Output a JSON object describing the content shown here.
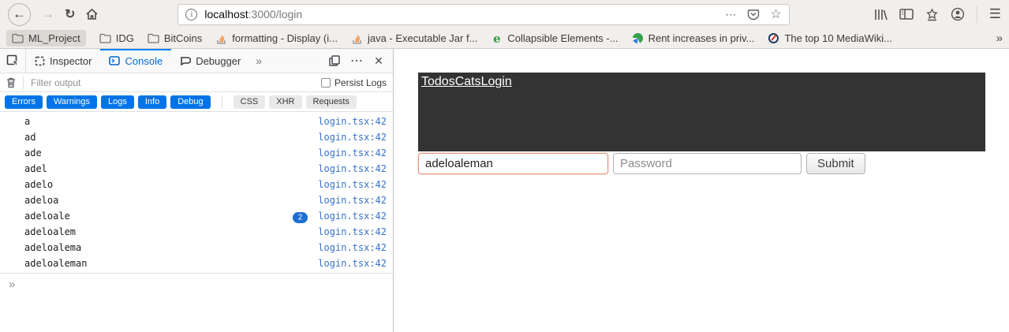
{
  "colors": {
    "accent_blue": "#0074e8",
    "active_tab_blue": "#0669cc",
    "link_blue": "#3672c8",
    "badge_blue": "#1d6fd3",
    "focus_orange": "#e8937c",
    "header_dark": "#333333",
    "chrome_grey": "#f1efed"
  },
  "glyphs": {
    "back": "←",
    "forward": "→",
    "reload": "↻",
    "info": "i",
    "page_actions": "⋯",
    "bookmark_star": "☆",
    "menu": "☰",
    "overflow": "»",
    "more_tabs": "»",
    "meatball": "⋯",
    "close": "✕",
    "prompt": "»",
    "e_favicon": "e"
  },
  "browser": {
    "url_host": "localhost",
    "url_suffix": ":3000/login"
  },
  "bookmarks": {
    "items": [
      {
        "label": "ML_Project",
        "icon": "folder"
      },
      {
        "label": "IDG",
        "icon": "folder"
      },
      {
        "label": "BitCoins",
        "icon": "folder"
      },
      {
        "label": "formatting - Display (i...",
        "icon": "stackoverflow"
      },
      {
        "label": "java - Executable Jar f...",
        "icon": "stackoverflow"
      },
      {
        "label": "Collapsible Elements -...",
        "icon": "e-green"
      },
      {
        "label": "Rent increases in priv...",
        "icon": "circle-green-blue"
      },
      {
        "label": "The top 10 MediaWiki...",
        "icon": "compass"
      }
    ]
  },
  "devtools": {
    "tabs": [
      {
        "label": "Inspector"
      },
      {
        "label": "Console"
      },
      {
        "label": "Debugger"
      }
    ],
    "filter": {
      "placeholder": "Filter output",
      "persist_label": "Persist Logs"
    },
    "level_pills": [
      {
        "label": "Errors"
      },
      {
        "label": "Warnings"
      },
      {
        "label": "Logs"
      },
      {
        "label": "Info"
      },
      {
        "label": "Debug"
      }
    ],
    "type_pills": [
      {
        "label": "CSS"
      },
      {
        "label": "XHR"
      },
      {
        "label": "Requests"
      }
    ],
    "console": {
      "rows": [
        {
          "text": "a",
          "location": "login.tsx:42"
        },
        {
          "text": "ad",
          "location": "login.tsx:42"
        },
        {
          "text": "ade",
          "location": "login.tsx:42"
        },
        {
          "text": "adel",
          "location": "login.tsx:42"
        },
        {
          "text": "adelo",
          "location": "login.tsx:42"
        },
        {
          "text": "adeloa",
          "location": "login.tsx:42"
        },
        {
          "text": "adeloale",
          "location": "login.tsx:42",
          "badge": "2"
        },
        {
          "text": "adeloalem",
          "location": "login.tsx:42"
        },
        {
          "text": "adeloalema",
          "location": "login.tsx:42"
        },
        {
          "text": "adeloaleman",
          "location": "login.tsx:42"
        }
      ]
    }
  },
  "page": {
    "nav_links": [
      {
        "label": "Todos"
      },
      {
        "label": "Cats"
      },
      {
        "label": "Login"
      }
    ],
    "form": {
      "username_value": "adeloaleman",
      "password_placeholder": "Password",
      "submit_label": "Submit"
    }
  }
}
